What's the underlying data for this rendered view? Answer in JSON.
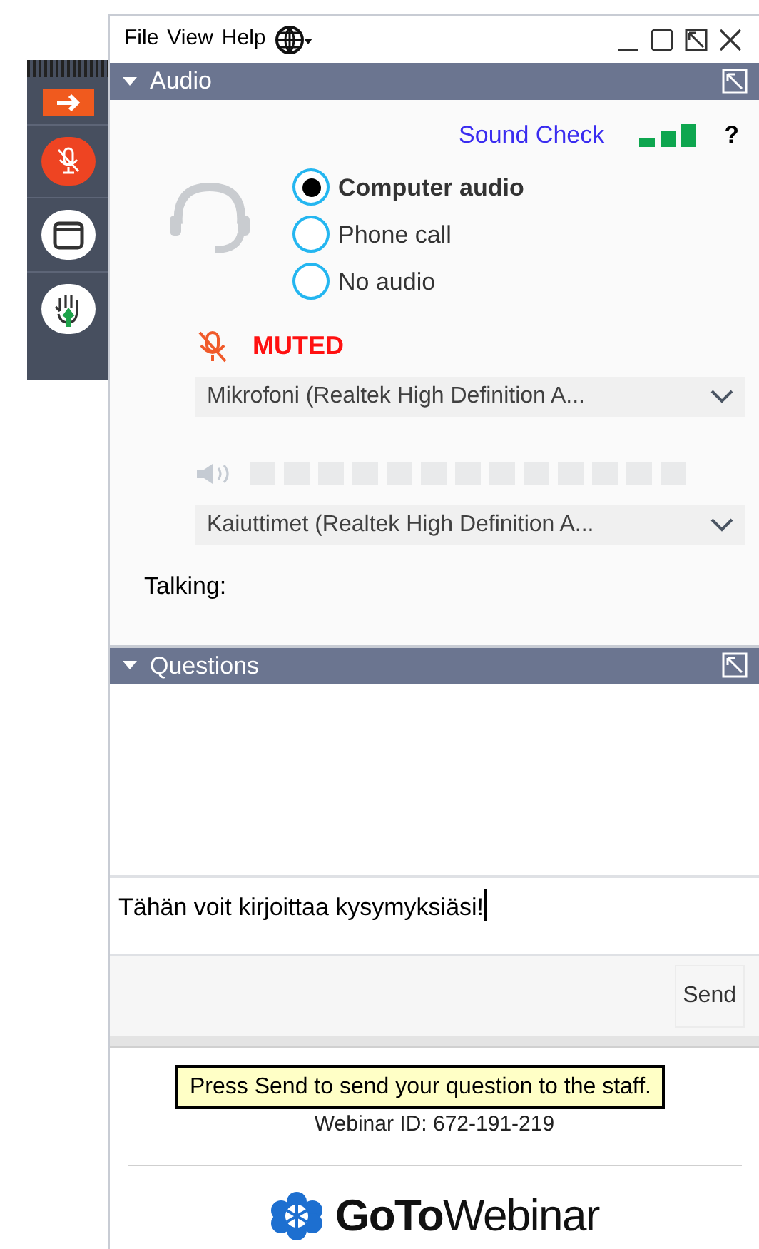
{
  "menu": [
    "File",
    "View",
    "Help"
  ],
  "audio": {
    "title": "Audio",
    "expanded": true,
    "sound_check": "Sound Check",
    "help": "?",
    "options": [
      {
        "label": "Computer audio",
        "selected": true
      },
      {
        "label": "Phone call",
        "selected": false
      },
      {
        "label": "No audio",
        "selected": false
      }
    ],
    "mic_status": "MUTED",
    "muted": true,
    "microphone": "Mikrofoni (Realtek High Definition A...",
    "speaker_meter": {
      "level": 0
    },
    "speaker": "Kaiuttimet (Realtek High Definition A...",
    "talking": "Talking:"
  },
  "questions": {
    "title": "Questions",
    "expanded": true,
    "input": "Tähän voit kirjoittaa kysymyksiäsi!",
    "send": "Send"
  },
  "tooltip": "Press Send to send your question to the staff.",
  "webinar_id": "Webinar ID: 672-191-219",
  "logo": "**GoTo**Webinar"
}
